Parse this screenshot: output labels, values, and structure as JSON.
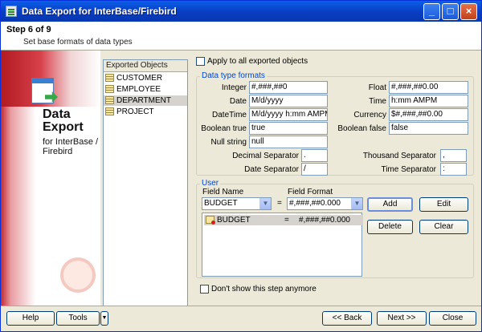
{
  "window": {
    "title": "Data Export for InterBase/Firebird"
  },
  "header": {
    "step": "Step 6 of 9",
    "subtitle": "Set base formats of data types"
  },
  "sidebar": {
    "title_big": "Data Export",
    "title_small": "for InterBase / Firebird"
  },
  "objects": {
    "header": "Exported Objects",
    "items": [
      "CUSTOMER",
      "EMPLOYEE",
      "DEPARTMENT",
      "PROJECT"
    ],
    "selected": "DEPARTMENT"
  },
  "apply_all": {
    "label": "Apply to all exported objects",
    "checked": false
  },
  "formats": {
    "group_title": "Data type formats",
    "integer": {
      "label": "Integer",
      "value": "#,###,##0"
    },
    "float": {
      "label": "Float",
      "value": "#,###,##0.00"
    },
    "date": {
      "label": "Date",
      "value": "M/d/yyyy"
    },
    "time": {
      "label": "Time",
      "value": "h:mm AMPM"
    },
    "datetime": {
      "label": "DateTime",
      "value": "M/d/yyyy h:mm AMPM"
    },
    "currency": {
      "label": "Currency",
      "value": "$#,###,##0.00"
    },
    "bool_true": {
      "label": "Boolean true",
      "value": "true"
    },
    "bool_false": {
      "label": "Boolean false",
      "value": "false"
    },
    "null_string": {
      "label": "Null string",
      "value": "null"
    },
    "decimal_sep": {
      "label": "Decimal Separator",
      "value": "."
    },
    "thousand_sep": {
      "label": "Thousand Separator",
      "value": ","
    },
    "date_sep": {
      "label": "Date Separator",
      "value": "/"
    },
    "time_sep": {
      "label": "Time Separator",
      "value": ":"
    }
  },
  "user": {
    "group_title": "User",
    "field_name_label": "Field Name",
    "field_format_label": "Field Format",
    "field_name_value": "BUDGET",
    "equals": "=",
    "field_format_value": "#,###,##0.000",
    "rows": [
      {
        "field": "BUDGET",
        "eq": "=",
        "format": "#,###,##0.000"
      }
    ],
    "add_label": "Add",
    "edit_label": "Edit",
    "delete_label": "Delete",
    "clear_label": "Clear"
  },
  "dont_show": {
    "label": "Don't show this step anymore",
    "checked": false
  },
  "footer": {
    "help": "Help",
    "tools": "Tools",
    "back": "<< Back",
    "next": "Next >>",
    "close": "Close"
  }
}
